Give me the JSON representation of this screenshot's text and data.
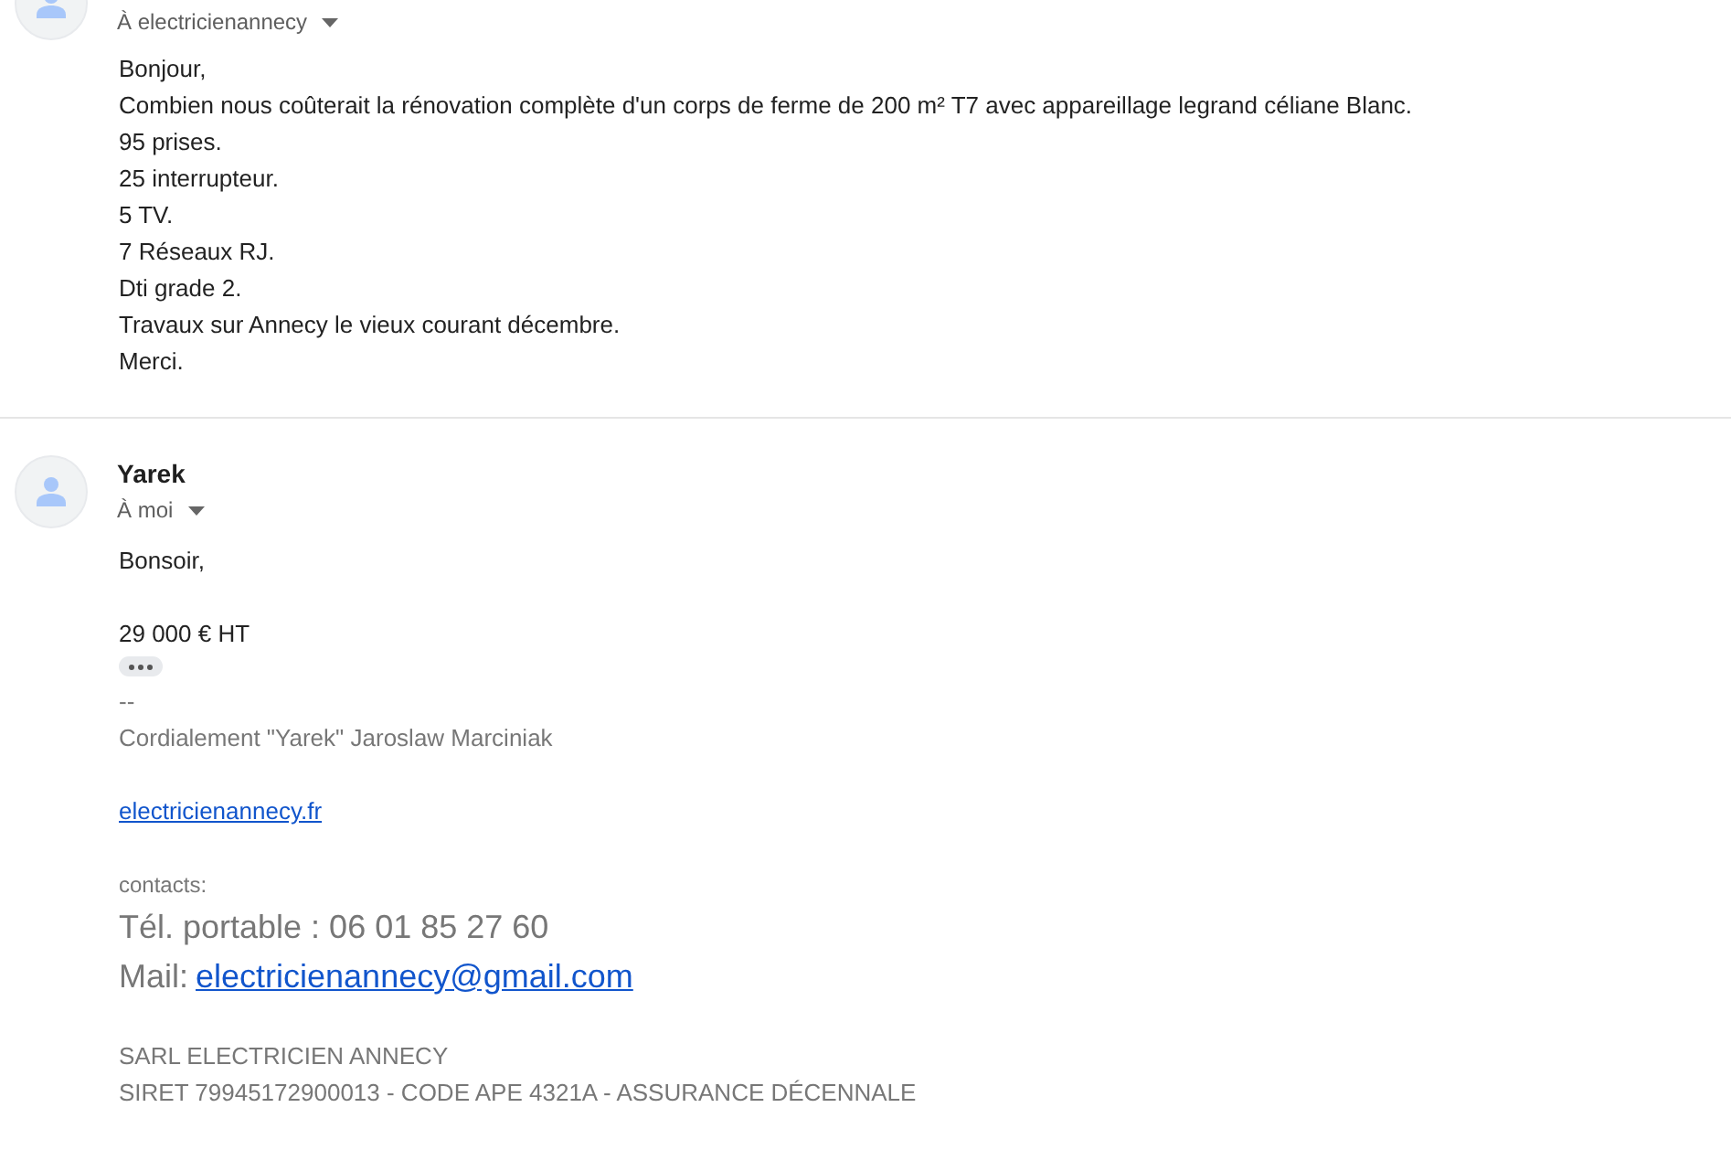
{
  "messages": [
    {
      "recipient": "À electricienannecy",
      "body": [
        [
          "Bonjour,",
          "Combien nous coûterait la rénovation complète d'un corps de ferme de 200 m² T7 avec appareillage legrand céliane Blanc.",
          "95 prises.",
          "25 interrupteur.",
          "5 TV.",
          "7 Réseaux RJ.",
          "Dti grade 2.",
          "Travaux sur Annecy le vieux courant décembre.",
          "Merci."
        ]
      ]
    },
    {
      "sender": "Yarek",
      "recipient": "À moi",
      "body": [
        [
          "Bonsoir,"
        ],
        [
          "29 000 € HT"
        ]
      ],
      "trimmed": true,
      "signature": [
        {
          "lines": [
            {
              "kind": "text",
              "text": "--"
            },
            {
              "kind": "text",
              "text": "Cordialement \"Yarek\" Jaroslaw Marciniak"
            }
          ]
        },
        {
          "lines": [
            {
              "kind": "link",
              "text": "electricienannecy.fr"
            }
          ]
        },
        {
          "lines": [
            {
              "kind": "small",
              "text": "contacts:"
            },
            {
              "kind": "large",
              "text": "Tél. portable : 06 01 85 27 60"
            },
            {
              "kind": "large_link",
              "label": "Mail:",
              "text": "electricienannecy@gmail.com"
            }
          ]
        },
        {
          "lines": [
            {
              "kind": "text",
              "text": "SARL ELECTRICIEN ANNECY"
            },
            {
              "kind": "text",
              "text": "SIRET  79945172900013 - CODE APE 4321A - ASSURANCE DÉCENNALE"
            }
          ]
        }
      ]
    }
  ]
}
